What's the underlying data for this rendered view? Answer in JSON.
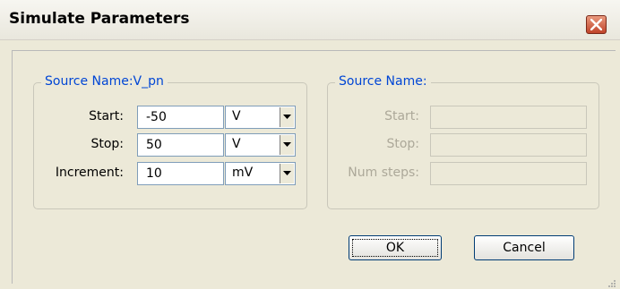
{
  "window": {
    "title": "Simulate Parameters",
    "close_icon": "close-icon",
    "close_color": "#c0432a"
  },
  "left_source": {
    "legend": "Source Name:V_pn",
    "rows": [
      {
        "label": "Start:",
        "value": "-50",
        "unit": "V"
      },
      {
        "label": "Stop:",
        "value": "50",
        "unit": "V"
      },
      {
        "label": "Increment:",
        "value": "10",
        "unit": "mV"
      }
    ]
  },
  "right_source": {
    "legend": "Source Name:",
    "rows": [
      {
        "label": "Start:",
        "value": ""
      },
      {
        "label": "Stop:",
        "value": ""
      },
      {
        "label": "Num steps:",
        "value": ""
      }
    ]
  },
  "buttons": {
    "ok": "OK",
    "cancel": "Cancel"
  },
  "colors": {
    "legend": "#0046d5",
    "disabled_text": "#aca899",
    "dialog_bg": "#ece9d8"
  }
}
